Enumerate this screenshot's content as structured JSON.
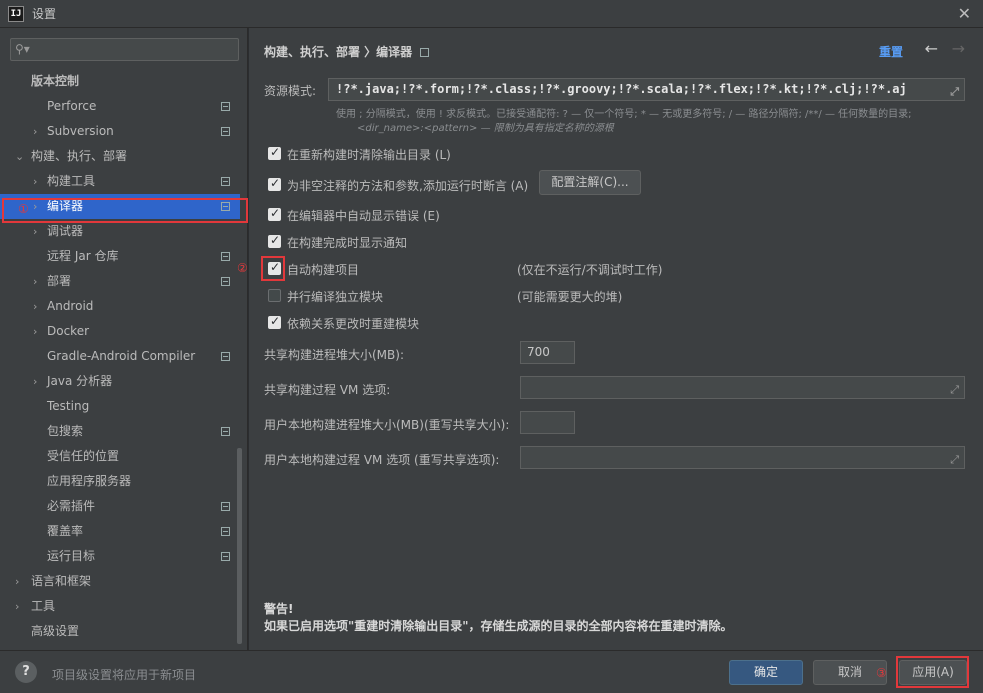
{
  "window": {
    "title": "设置",
    "app_icon_text": "IJ",
    "close_icon": "close-icon"
  },
  "sidebar": {
    "search_placeholder": "",
    "items": [
      {
        "label": "版本控制",
        "indent": 0,
        "arrow": "",
        "pin": false,
        "selected": false,
        "bold": true
      },
      {
        "label": "Perforce",
        "indent": 1,
        "arrow": "",
        "pin": true,
        "selected": false
      },
      {
        "label": "Subversion",
        "indent": 1,
        "arrow": "›",
        "pin": true,
        "selected": false
      },
      {
        "label": "构建、执行、部署",
        "indent": 0,
        "arrow": "⌄",
        "pin": false,
        "selected": false
      },
      {
        "label": "构建工具",
        "indent": 1,
        "arrow": "›",
        "pin": true,
        "selected": false
      },
      {
        "label": "编译器",
        "indent": 1,
        "arrow": "›",
        "pin": true,
        "selected": true
      },
      {
        "label": "调试器",
        "indent": 1,
        "arrow": "›",
        "pin": false,
        "selected": false
      },
      {
        "label": "远程 Jar 仓库",
        "indent": 1,
        "arrow": "",
        "pin": true,
        "selected": false
      },
      {
        "label": "部署",
        "indent": 1,
        "arrow": "›",
        "pin": true,
        "selected": false
      },
      {
        "label": "Android",
        "indent": 1,
        "arrow": "›",
        "pin": false,
        "selected": false
      },
      {
        "label": "Docker",
        "indent": 1,
        "arrow": "›",
        "pin": false,
        "selected": false
      },
      {
        "label": "Gradle-Android Compiler",
        "indent": 1,
        "arrow": "",
        "pin": true,
        "selected": false
      },
      {
        "label": "Java 分析器",
        "indent": 1,
        "arrow": "›",
        "pin": false,
        "selected": false
      },
      {
        "label": "Testing",
        "indent": 1,
        "arrow": "",
        "pin": false,
        "selected": false
      },
      {
        "label": "包搜索",
        "indent": 1,
        "arrow": "",
        "pin": true,
        "selected": false
      },
      {
        "label": "受信任的位置",
        "indent": 1,
        "arrow": "",
        "pin": false,
        "selected": false
      },
      {
        "label": "应用程序服务器",
        "indent": 1,
        "arrow": "",
        "pin": false,
        "selected": false
      },
      {
        "label": "必需插件",
        "indent": 1,
        "arrow": "",
        "pin": true,
        "selected": false
      },
      {
        "label": "覆盖率",
        "indent": 1,
        "arrow": "",
        "pin": true,
        "selected": false
      },
      {
        "label": "运行目标",
        "indent": 1,
        "arrow": "",
        "pin": true,
        "selected": false
      },
      {
        "label": "语言和框架",
        "indent": 0,
        "arrow": "›",
        "pin": false,
        "selected": false
      },
      {
        "label": "工具",
        "indent": 0,
        "arrow": "›",
        "pin": false,
        "selected": false
      },
      {
        "label": "高级设置",
        "indent": 0,
        "arrow": "",
        "pin": false,
        "selected": false
      }
    ],
    "annotation_1": "①"
  },
  "main": {
    "breadcrumb": "构建、执行、部署 〉编译器",
    "reset_label": "重置",
    "back_icon": "←",
    "forward_icon": "→",
    "resource_label": "资源模式:",
    "resource_value": "!?*.java;!?*.form;!?*.class;!?*.groovy;!?*.scala;!?*.flex;!?*.kt;!?*.clj;!?*.aj",
    "hint_line1": "使用 ; 分隔模式，使用 ! 求反模式。已接受通配符: ? — 仅一个符号; * — 无或更多符号; / — 路径分隔符; /**/ — 任何数量的目录;",
    "hint_line2": "<dir_name>:<pattern> — 限制为具有指定名称的源根",
    "checkboxes": [
      {
        "label": "在重新构建时清除输出目录 (L)",
        "checked": true
      },
      {
        "label": "为非空注释的方法和参数,添加运行时断言 (A)",
        "checked": true
      },
      {
        "label": "在编辑器中自动显示错误 (E)",
        "checked": true
      },
      {
        "label": "在构建完成时显示通知",
        "checked": true
      },
      {
        "label": "自动构建项目",
        "checked": true
      },
      {
        "label": "并行编译独立模块",
        "checked": false
      },
      {
        "label": "依赖关系更改时重建模块",
        "checked": true
      }
    ],
    "configure_button": "配置注解(C)...",
    "auto_build_note": "(仅在不运行/不调试时工作)",
    "parallel_note": "(可能需要更大的堆)",
    "annotation_2": "②",
    "heap_label": "共享构建进程堆大小(MB):",
    "heap_value": "700",
    "vm_label": "共享构建过程 VM 选项:",
    "vm_value": "",
    "user_heap_label": "用户本地构建进程堆大小(MB)(重写共享大小):",
    "user_heap_value": "",
    "user_vm_label": "用户本地构建过程 VM 选项 (重写共享选项):",
    "user_vm_value": "",
    "warning_title": "警告!",
    "warning_text": "如果已启用选项\"重建时清除输出目录\"，存储生成源的目录的全部内容将在重建时清除。"
  },
  "footer": {
    "help_label": "?",
    "info_text": "项目级设置将应用于新项目",
    "ok_label": "确定",
    "cancel_label": "取消",
    "apply_label": "应用(A)",
    "annotation_3": "③"
  }
}
